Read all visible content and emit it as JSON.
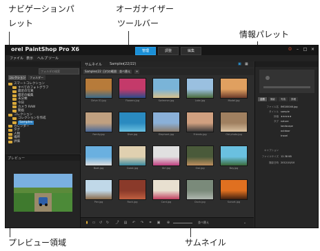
{
  "callouts": {
    "nav_line1": "ナビゲーションパ",
    "nav_line2": "レット",
    "organizer_line1": "オーガナイザー",
    "organizer_line2": "ツールバー",
    "info": "情報パレット",
    "preview": "プレビュー領域",
    "thumbnails": "サムネイル"
  },
  "app": {
    "title": "orel PaintShop Pro X6",
    "tabs": [
      {
        "label": "管理"
      },
      {
        "label": "調整"
      },
      {
        "label": "編集"
      }
    ],
    "active_tab": "管理",
    "menu": [
      "ファイル",
      "表示",
      "ヘルプ",
      "ツール"
    ],
    "nav": {
      "search_placeholder": "フォルダの検索",
      "tabs": [
        {
          "label": "コレクション"
        },
        {
          "label": "フォルダー"
        }
      ],
      "tree": [
        {
          "label": "スマートコレクション",
          "depth": 0
        },
        {
          "label": "すべてのフォトグラフ",
          "depth": 1
        },
        {
          "label": "最近の写真",
          "depth": 1
        },
        {
          "label": "最近の編集",
          "depth": 1
        },
        {
          "label": "未分類",
          "depth": 1
        },
        {
          "label": "今日",
          "depth": 1
        },
        {
          "label": "カメラ RAW",
          "depth": 1
        },
        {
          "label": "動画",
          "depth": 1
        },
        {
          "label": "コレクション",
          "depth": 0
        },
        {
          "label": "コレクションを作成",
          "depth": 1
        },
        {
          "label": "Samples",
          "depth": 1,
          "selected": true
        },
        {
          "label": "カレンダー",
          "depth": 0
        },
        {
          "label": "タグ",
          "depth": 0
        },
        {
          "label": "人物",
          "depth": 0
        },
        {
          "label": "場所",
          "depth": 0
        },
        {
          "label": "評価",
          "depth": 0
        }
      ]
    },
    "preview": {
      "header": "プレビュー"
    },
    "organizer": {
      "breadcrumb": "サムネイル",
      "folder": "Samples",
      "count": "(22/22)",
      "buttons": [
        {
          "label": "Samples(22)"
        },
        {
          "label": "日付の範囲"
        },
        {
          "label": "並べ替え"
        }
      ]
    },
    "thumbnails": [
      {
        "caption": "Drive 01.jpg"
      },
      {
        "caption": "Flowers.jpg"
      },
      {
        "caption": "Swimmer.jpg"
      },
      {
        "caption": "Lake.jpg"
      },
      {
        "caption": "Model.jpg"
      },
      {
        "caption": "Family.jpg"
      },
      {
        "caption": "Dive.jpg"
      },
      {
        "caption": "Elephant.jpg"
      },
      {
        "caption": "Friends.jpg"
      },
      {
        "caption": "Old photo.jpg"
      },
      {
        "caption": "Boat.jpg"
      },
      {
        "caption": "Coast.jpg"
      },
      {
        "caption": "Girl.jpg"
      },
      {
        "caption": "Owl.jpg"
      },
      {
        "caption": "Bay.jpg"
      },
      {
        "caption": "Pier.jpg"
      },
      {
        "caption": "Rock.jpg"
      },
      {
        "caption": "Card.jpg"
      },
      {
        "caption": "Duck.jpg"
      },
      {
        "caption": "Sunset.jpg"
      }
    ],
    "info": {
      "tabs": [
        {
          "label": "全般"
        },
        {
          "label": "撮影"
        },
        {
          "label": "写真"
        },
        {
          "label": "詳細"
        }
      ],
      "rows": [
        {
          "k": "ファイル名",
          "v": "IMG00046.jpg"
        },
        {
          "k": "タイトル",
          "v": "sample"
        },
        {
          "k": "評価",
          "v": "★★★★★"
        },
        {
          "k": "タグ",
          "v": "nature"
        },
        {
          "k": "",
          "v": "landscape"
        },
        {
          "k": "",
          "v": "outdoor"
        },
        {
          "k": "",
          "v": "travel"
        },
        {
          "k": "キャプション",
          "v": ""
        },
        {
          "k": "ファイルサイズ",
          "v": "12.38 KB"
        },
        {
          "k": "撮影日時",
          "v": "2012/10/10"
        }
      ]
    },
    "bottom": {
      "zoom_label": "並べ替え"
    }
  }
}
